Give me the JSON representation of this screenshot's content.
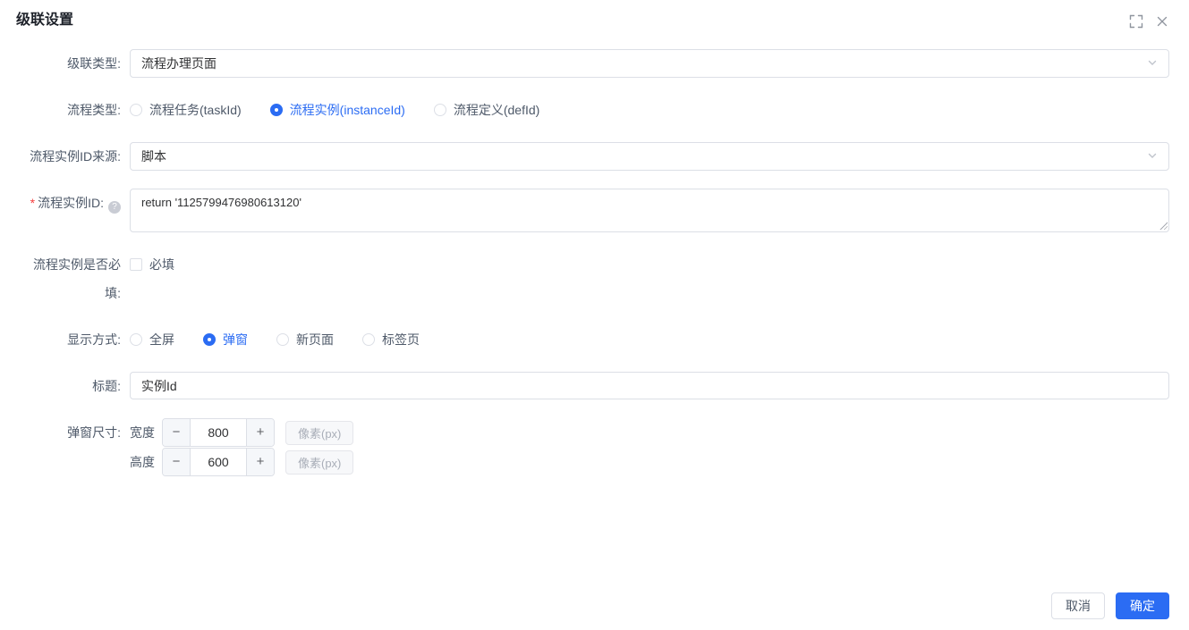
{
  "dialog": {
    "title": "级联设置"
  },
  "icons": {
    "fullscreen": "corner-brackets",
    "close": "x-mark",
    "help_glyph": "?",
    "select_arrow": "chevron-down",
    "minus_glyph": "−",
    "plus_glyph": "+"
  },
  "form": {
    "cascade_type": {
      "label": "级联类型:",
      "value": "流程办理页面"
    },
    "process_type": {
      "label": "流程类型:",
      "options": [
        {
          "label": "流程任务(taskId)",
          "selected": false
        },
        {
          "label": "流程实例(instanceId)",
          "selected": true
        },
        {
          "label": "流程定义(defId)",
          "selected": false
        }
      ]
    },
    "instance_id_source": {
      "label": "流程实例ID来源:",
      "value": "脚本"
    },
    "instance_id": {
      "required_mark": "*",
      "label": "流程实例ID:",
      "value": "return '1125799476980613120'"
    },
    "instance_required": {
      "label": "流程实例是否必填:",
      "option_label": "必填",
      "checked": false
    },
    "display_mode": {
      "label": "显示方式:",
      "options": [
        {
          "label": "全屏",
          "selected": false
        },
        {
          "label": "弹窗",
          "selected": true
        },
        {
          "label": "新页面",
          "selected": false
        },
        {
          "label": "标签页",
          "selected": false
        }
      ]
    },
    "title_field": {
      "label": "标题:",
      "value": "实例Id"
    },
    "popup_size": {
      "label": "弹窗尺寸:",
      "rows": [
        {
          "dimension_label": "宽度",
          "value": "800",
          "unit_label": "像素(px)"
        },
        {
          "dimension_label": "高度",
          "value": "600",
          "unit_label": "像素(px)"
        }
      ]
    }
  },
  "footer": {
    "cancel_label": "取消",
    "confirm_label": "确定"
  },
  "colors": {
    "accent": "#2b6cf3",
    "border": "#dcdfe6",
    "label_text": "#4e5969",
    "required_mark": "#f53f3f"
  }
}
